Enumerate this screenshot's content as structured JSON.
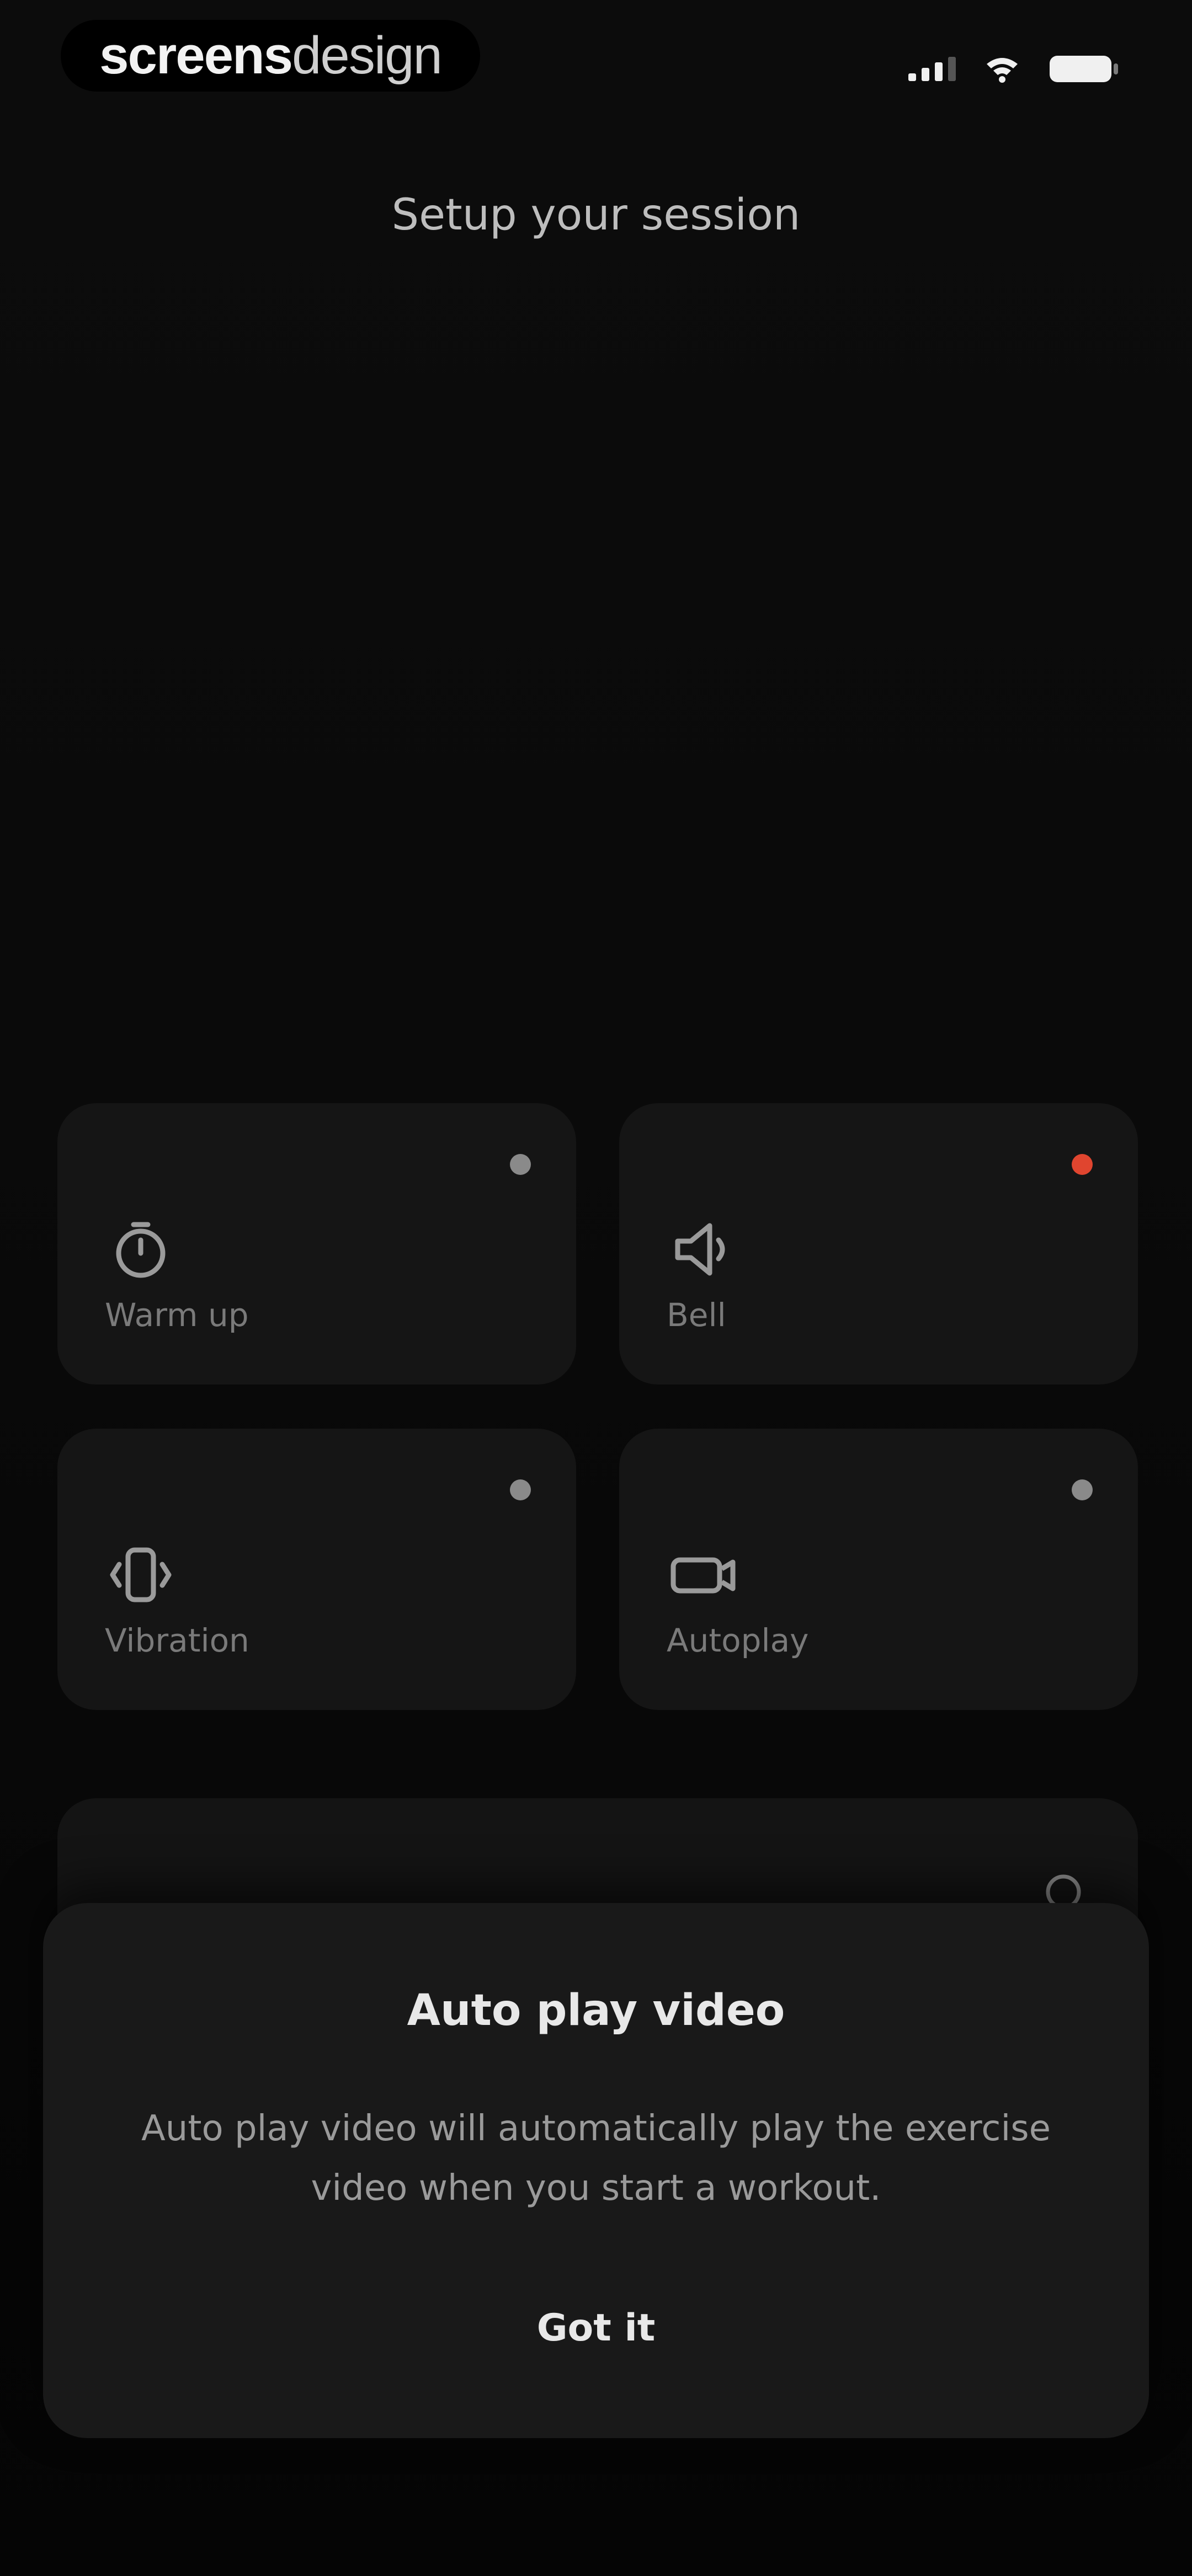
{
  "status_bar": {
    "brand": {
      "part_a": "screens",
      "part_b": "design"
    },
    "icons": [
      "signal-icon",
      "wifi-icon",
      "battery-icon"
    ]
  },
  "page": {
    "title": "Setup your session"
  },
  "tiles": [
    {
      "label": "Warm up",
      "icon": "stopwatch-icon",
      "active": false
    },
    {
      "label": "Bell",
      "icon": "speaker-icon",
      "active": true
    },
    {
      "label": "Vibration",
      "icon": "vibration-icon",
      "active": false
    },
    {
      "label": "Autoplay",
      "icon": "video-icon",
      "active": false
    }
  ],
  "colors": {
    "accent": "#e0452f",
    "tile_background": "#151515",
    "sheet_background": "#191919"
  },
  "dialog": {
    "title": "Auto play video",
    "message": "Auto play video will automatically play the exercise video when you start a workout.",
    "button_label": "Got it"
  }
}
